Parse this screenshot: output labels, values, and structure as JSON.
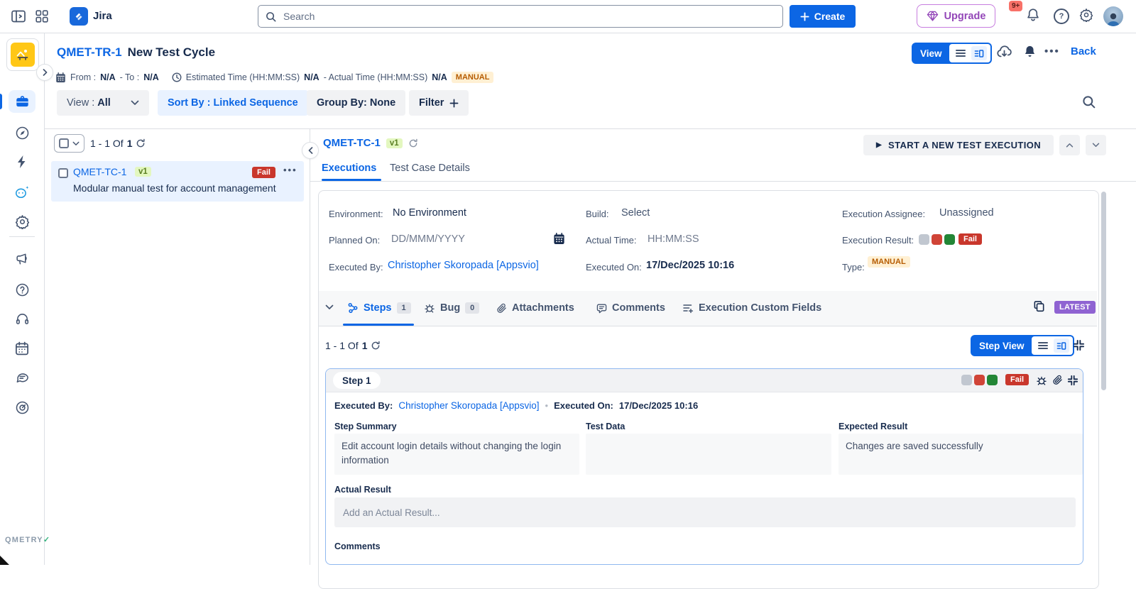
{
  "topbar": {
    "app_name": "Jira",
    "search_placeholder": "Search",
    "create_label": "Create",
    "upgrade_label": "Upgrade",
    "notifications_count": "9+"
  },
  "sidebar": {
    "items": [
      "project-avatar",
      "work-items",
      "discovery-compass",
      "automation-bolt",
      "assistant-bot",
      "settings-gear",
      "announcements-megaphone",
      "help-question",
      "support-headset",
      "calendar",
      "feedback-chat",
      "goals-target"
    ],
    "brand": "QMETRY"
  },
  "page_header": {
    "key": "QMET-TR-1",
    "title": "New Test Cycle",
    "from_label": "From :",
    "from_value": "N/A",
    "to_label": "- To :",
    "to_value": "N/A",
    "estimated_label": "Estimated Time (HH:MM:SS)",
    "estimated_value": "N/A",
    "actual_label": "- Actual Time (HH:MM:SS)",
    "actual_value": "N/A",
    "type_badge": "MANUAL",
    "view_toggle_label": "View",
    "back_label": "Back"
  },
  "toolbar": {
    "view_label": "View :",
    "view_value": "All",
    "sort_label": "Sort By : Linked Sequence",
    "group_label": "Group By: None",
    "filter_label": "Filter"
  },
  "test_case_list": {
    "pagination_prefix": "1 - 1 Of",
    "pagination_total": "1",
    "items": [
      {
        "key": "QMET-TC-1",
        "version": "v1",
        "status": "Fail",
        "summary": "Modular manual test for account management"
      }
    ]
  },
  "execution_panel": {
    "key": "QMET-TC-1",
    "version": "v1",
    "start_button_label": "START A NEW TEST EXECUTION",
    "tabs": [
      {
        "label": "Executions"
      },
      {
        "label": "Test Case Details"
      }
    ],
    "fields": {
      "environment_label": "Environment:",
      "environment_value": "No Environment",
      "build_label": "Build:",
      "build_value": "Select",
      "assignee_label": "Execution Assignee:",
      "assignee_value": "Unassigned",
      "planned_on_label": "Planned On:",
      "planned_on_value": "DD/MMM/YYYY",
      "actual_time_label": "Actual Time:",
      "actual_time_value": "HH:MM:SS",
      "result_label": "Execution Result:",
      "result_value": "Fail",
      "executed_by_label": "Executed By:",
      "executed_by_value": "Christopher Skoropada [Appsvio]",
      "executed_on_label": "Executed On:",
      "executed_on_value": "17/Dec/2025 10:16",
      "type_label": "Type:",
      "type_value": "MANUAL"
    },
    "section_tabs": [
      {
        "label": "Steps",
        "count": "1"
      },
      {
        "label": "Bug",
        "count": "0"
      },
      {
        "label": "Attachments"
      },
      {
        "label": "Comments"
      },
      {
        "label": "Execution Custom Fields"
      }
    ],
    "latest_badge": "LATEST",
    "steps_toolbar": {
      "pagination_prefix": "1 - 1 Of",
      "pagination_total": "1",
      "step_view_label": "Step View"
    },
    "step": {
      "title": "Step 1",
      "status": "Fail",
      "executed_by_label": "Executed By:",
      "executed_by_value": "Christopher Skoropada [Appsvio]",
      "executed_on_label": "Executed On:",
      "executed_on_value": "17/Dec/2025 10:16",
      "summary_label": "Step Summary",
      "summary_value": "Edit account login details without changing the login information",
      "test_data_label": "Test Data",
      "test_data_value": "",
      "expected_label": "Expected Result",
      "expected_value": "Changes are saved successfully",
      "actual_result_label": "Actual Result",
      "actual_result_placeholder": "Add an Actual Result...",
      "comments_label": "Comments"
    }
  },
  "colors": {
    "brand_blue": "#0C66E4",
    "fail_red": "#C9372C",
    "pass_green": "#238636",
    "not_executed_gray": "#C1C7D0",
    "manual_badge_bg": "#FFF0D3",
    "manual_badge_text": "#B65C02",
    "latest_purple": "#8F63D2",
    "selected_row_bg": "#E9F2FF",
    "upgrade_purple": "#9346B8"
  }
}
